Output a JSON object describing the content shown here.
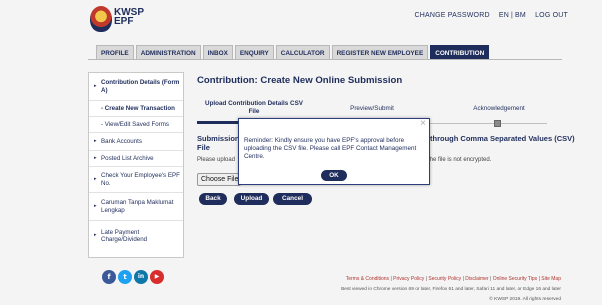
{
  "header": {
    "logo_text_line1": "KWSP",
    "logo_text_line2": "EPF",
    "change_password": "CHANGE PASSWORD",
    "lang_en": "EN",
    "lang_sep": "|",
    "lang_bm": "BM",
    "logout": "LOG OUT"
  },
  "tabs": [
    {
      "label": "PROFILE"
    },
    {
      "label": "ADMINISTRATION"
    },
    {
      "label": "INBOX"
    },
    {
      "label": "ENQUIRY"
    },
    {
      "label": "CALCULATOR"
    },
    {
      "label": "REGISTER NEW EMPLOYEE"
    },
    {
      "label": "CONTRIBUTION",
      "active": true
    }
  ],
  "sidebar": {
    "items": [
      {
        "label": "Contribution Details (Form A)",
        "arrow": "▸"
      },
      {
        "label": "- Create New Transaction"
      },
      {
        "label": "- View/Edit Saved Forms"
      },
      {
        "label": "Bank Accounts",
        "arrow": "▸"
      },
      {
        "label": "Posted List Archive",
        "arrow": "▸"
      },
      {
        "label": "Check Your Employee's EPF No.",
        "arrow": "▸"
      },
      {
        "label": "Caruman Tanpa Maklumat Lengkap",
        "arrow": "▸"
      },
      {
        "label": "Late Payment Charge/Dividend",
        "arrow": "▸"
      }
    ]
  },
  "main": {
    "title": "Contribution: Create New Online Submission",
    "steps": [
      {
        "label": "Upload Contribution Details CSV File"
      },
      {
        "label": "Preview/Submit"
      },
      {
        "label": "Acknowledgement"
      }
    ],
    "section_title_left": "Submission",
    "section_title_left2": "File",
    "section_title_right": "through Comma Separated Values (CSV)",
    "instruction_left": "Please upload",
    "instruction_right": "the file is not encrypted.",
    "choose_file": "Choose File",
    "buttons": {
      "back": "Back",
      "upload": "Upload",
      "cancel": "Cancel"
    }
  },
  "modal": {
    "close": "×",
    "message": "Reminder: Kindly ensure you have EPF's approval before uploading the CSV file. Please call EPF Contact Management Centre.",
    "ok": "OK"
  },
  "social": [
    {
      "icon": "facebook-icon",
      "glyph": "f",
      "color": "#3b5998"
    },
    {
      "icon": "twitter-icon",
      "glyph": "t",
      "color": "#1da1f2"
    },
    {
      "icon": "linkedin-icon",
      "glyph": "in",
      "color": "#0e76a8"
    },
    {
      "icon": "youtube-icon",
      "glyph": "▶",
      "color": "#d92c2c"
    }
  ],
  "footer": {
    "links": [
      "Terms & Conditions",
      "Privacy Policy",
      "Security Policy",
      "Disclaimer",
      "Online Security Tips",
      "Site Map"
    ],
    "browser": "Best viewed in Chrome version 69 or later, Firefox 61 and later, Safari 11 and later, or Edge 16 and later",
    "copyright": "© KWSP 2019. All rights reserved"
  },
  "colors": {
    "brand": "#1f2d5c",
    "footer_link": "#b0352f"
  }
}
